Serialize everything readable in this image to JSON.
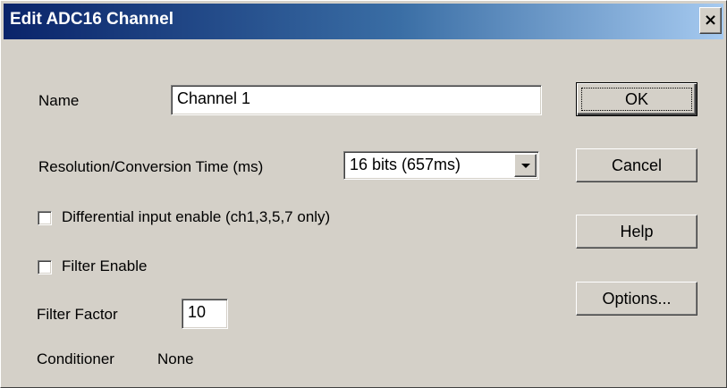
{
  "window": {
    "title": "Edit ADC16 Channel",
    "close_glyph": "×"
  },
  "form": {
    "name_label": "Name",
    "name_value": "Channel 1",
    "resolution_label": "Resolution/Conversion Time (ms)",
    "resolution_selected": "16 bits (657ms)",
    "differential_label": "Differential input enable (ch1,3,5,7 only)",
    "differential_checked": false,
    "filter_enable_label": "Filter Enable",
    "filter_enable_checked": false,
    "filter_factor_label": "Filter Factor",
    "filter_factor_value": "10",
    "conditioner_label": "Conditioner",
    "conditioner_value": "None"
  },
  "buttons": {
    "ok": "OK",
    "cancel": "Cancel",
    "help": "Help",
    "options": "Options..."
  },
  "colors": {
    "title_gradient_start": "#0a246a",
    "title_gradient_end": "#a6caf0",
    "face": "#d4d0c8"
  }
}
